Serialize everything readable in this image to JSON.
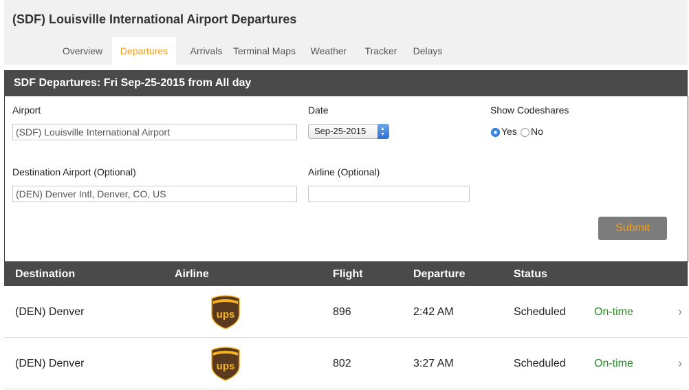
{
  "page": {
    "title": "(SDF) Louisville International Airport Departures"
  },
  "tabs": [
    {
      "label": "Overview"
    },
    {
      "label": "Departures"
    },
    {
      "label": "Arrivals"
    },
    {
      "label": "Terminal Maps"
    },
    {
      "label": "Weather"
    },
    {
      "label": "Tracker"
    },
    {
      "label": "Delays"
    }
  ],
  "panel": {
    "title": "SDF Departures: Fri Sep-25-2015 from All day"
  },
  "form": {
    "airport_label": "Airport",
    "airport_value": "(SDF) Louisville International Airport",
    "date_label": "Date",
    "date_value": "Sep-25-2015",
    "codeshares_label": "Show Codeshares",
    "codeshares_yes": "Yes",
    "codeshares_no": "No",
    "codeshares_selected": "Yes",
    "destination_label": "Destination Airport (Optional)",
    "destination_value": "(DEN) Denver Intl, Denver, CO, US",
    "airline_label": "Airline (Optional)",
    "airline_value": "",
    "submit_label": "Submit"
  },
  "table": {
    "headers": {
      "destination": "Destination",
      "airline": "Airline",
      "flight": "Flight",
      "departure": "Departure",
      "status": "Status"
    },
    "rows": [
      {
        "destination": "(DEN) Denver",
        "airline_logo": "ups-logo-icon",
        "flight": "896",
        "departure": "2:42 AM",
        "status": "Scheduled",
        "punctuality": "On-time"
      },
      {
        "destination": "(DEN) Denver",
        "airline_logo": "ups-logo-icon",
        "flight": "802",
        "departure": "3:27 AM",
        "status": "Scheduled",
        "punctuality": "On-time"
      }
    ]
  },
  "colors": {
    "accent": "#f39c1f",
    "header_bar": "#4a4a4a",
    "on_time": "#2a8a2a",
    "ups_brown": "#5a3a1e",
    "ups_gold": "#f5b324"
  }
}
